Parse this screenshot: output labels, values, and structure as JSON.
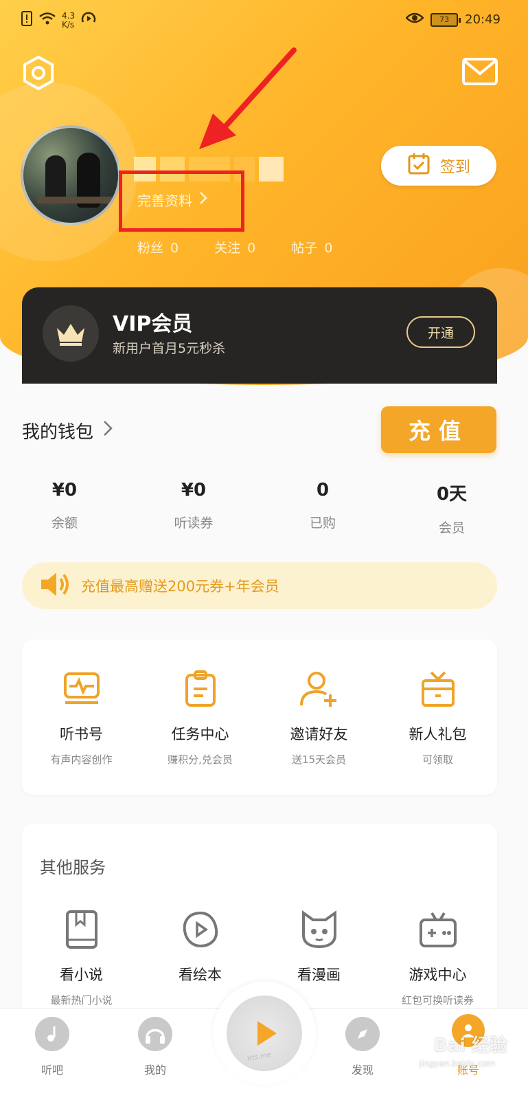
{
  "status_bar": {
    "speed_value": "4.3",
    "speed_unit": "K/s",
    "battery": "73",
    "time": "20:49"
  },
  "profile": {
    "complete_profile_label": "完善资料",
    "signin_label": "签到",
    "stats": [
      {
        "label": "粉丝",
        "value": "0"
      },
      {
        "label": "关注",
        "value": "0"
      },
      {
        "label": "帖子",
        "value": "0"
      }
    ]
  },
  "vip": {
    "title": "VIP会员",
    "subtitle": "新用户首月5元秒杀",
    "open_label": "开通"
  },
  "wallet": {
    "title": "我的钱包",
    "recharge_label": "充值",
    "items": [
      {
        "value": "¥0",
        "label": "余额"
      },
      {
        "value": "¥0",
        "label": "听读券"
      },
      {
        "value": "0",
        "label": "已购"
      },
      {
        "value": "0天",
        "label": "会员"
      }
    ],
    "promo": "充值最高赠送200元券+年会员"
  },
  "features": [
    {
      "title": "听书号",
      "subtitle": "有声内容创作",
      "icon": "audio-card-icon"
    },
    {
      "title": "任务中心",
      "subtitle": "赚积分,兑会员",
      "icon": "clipboard-icon"
    },
    {
      "title": "邀请好友",
      "subtitle": "送15天会员",
      "icon": "add-user-icon"
    },
    {
      "title": "新人礼包",
      "subtitle": "可领取",
      "icon": "gift-icon"
    }
  ],
  "other_services": {
    "heading": "其他服务",
    "items": [
      {
        "title": "看小说",
        "subtitle": "最新热门小说",
        "icon": "book-icon"
      },
      {
        "title": "看绘本",
        "subtitle": "",
        "icon": "play-bubble-icon"
      },
      {
        "title": "看漫画",
        "subtitle": "",
        "icon": "cat-face-icon"
      },
      {
        "title": "游戏中心",
        "subtitle": "红包可换听读券",
        "icon": "gamepad-icon"
      }
    ]
  },
  "nav": [
    {
      "label": "听吧"
    },
    {
      "label": "我的"
    },
    {
      "label": "发现"
    },
    {
      "label": "账号"
    }
  ],
  "center_play_text": "lrts.me",
  "watermark": {
    "text": "Bai 经验",
    "sub": "jingyan.baidu.com"
  },
  "colors": {
    "accent": "#f4a629",
    "vip_bg": "#262523",
    "annotation": "#ee2222"
  }
}
